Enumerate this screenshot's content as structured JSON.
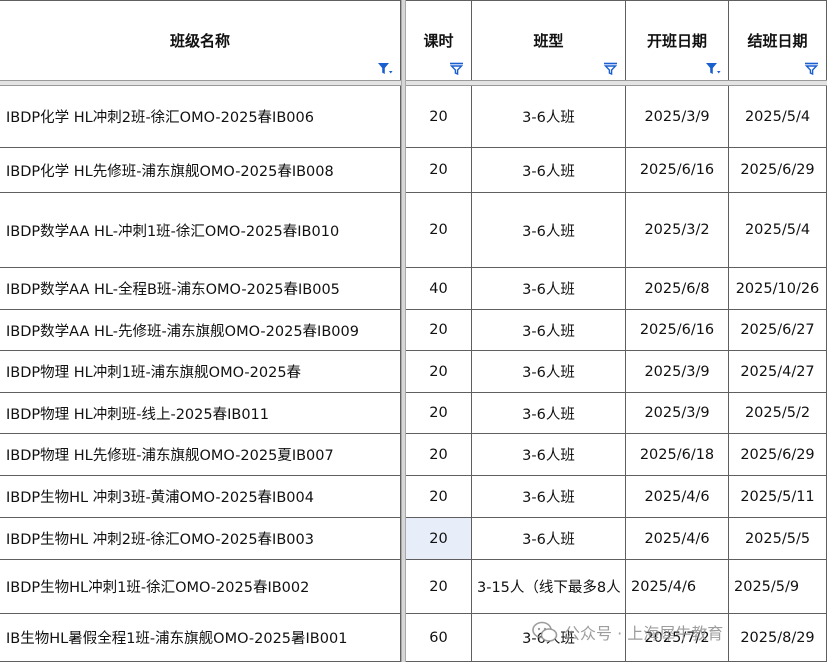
{
  "headers": [
    {
      "label": "班级名称",
      "filter": "active"
    },
    {
      "label": "课时",
      "filter": "funnel"
    },
    {
      "label": "班型",
      "filter": "funnel"
    },
    {
      "label": "开班日期",
      "filter": "active"
    },
    {
      "label": "结班日期",
      "filter": "funnel"
    }
  ],
  "rows": [
    {
      "name": "IBDP化学 HL冲刺2班-徐汇OMO-2025春IB006",
      "hours": "20",
      "type": "3-6人班",
      "start": "2025/3/9",
      "end": "2025/5/4"
    },
    {
      "name": "IBDP化学 HL先修班-浦东旗舰OMO-2025春IB008",
      "hours": "20",
      "type": "3-6人班",
      "start": "2025/6/16",
      "end": "2025/6/29"
    },
    {
      "name": "IBDP数学AA HL-冲刺1班-徐汇OMO-2025春IB010",
      "hours": "20",
      "type": "3-6人班",
      "start": "2025/3/2",
      "end": "2025/5/4"
    },
    {
      "name": "IBDP数学AA HL-全程B班-浦东OMO-2025春IB005",
      "hours": "40",
      "type": "3-6人班",
      "start": "2025/6/8",
      "end": "2025/10/26"
    },
    {
      "name": "IBDP数学AA HL-先修班-浦东旗舰OMO-2025春IB009",
      "hours": "20",
      "type": "3-6人班",
      "start": "2025/6/16",
      "end": "2025/6/27"
    },
    {
      "name": "IBDP物理 HL冲刺1班-浦东旗舰OMO-2025春",
      "hours": "20",
      "type": "3-6人班",
      "start": "2025/3/9",
      "end": "2025/4/27"
    },
    {
      "name": "IBDP物理 HL冲刺班-线上-2025春IB011",
      "hours": "20",
      "type": "3-6人班",
      "start": "2025/3/9",
      "end": "2025/5/2"
    },
    {
      "name": "IBDP物理 HL先修班-浦东旗舰OMO-2025夏IB007",
      "hours": "20",
      "type": "3-6人班",
      "start": "2025/6/18",
      "end": "2025/6/29"
    },
    {
      "name": "IBDP生物HL 冲刺3班-黄浦OMO-2025春IB004",
      "hours": "20",
      "type": "3-6人班",
      "start": "2025/4/6",
      "end": "2025/5/11"
    },
    {
      "name": "IBDP生物HL 冲刺2班-徐汇OMO-2025春IB003",
      "hours": "20",
      "type": "3-6人班",
      "start": "2025/4/6",
      "end": "2025/5/5"
    },
    {
      "name": "IBDP生物HL冲刺1班-徐汇OMO-2025春IB002",
      "hours": "20",
      "type": "3-15人（线下最多8人",
      "start": "2025/4/6",
      "end": "2025/5/9"
    },
    {
      "name": "IB生物HL暑假全程1班-浦东旗舰OMO-2025暑IB001",
      "hours": "60",
      "type": "3-6人班",
      "start": "2025/7/2",
      "end": "2025/8/29"
    }
  ],
  "watermark": {
    "label": "公众号 · 上海犀牛教育"
  },
  "colors": {
    "filter_icon": "#1a5fd0",
    "selected_cell": "#e7eef9",
    "grid": "#5f5f5f"
  }
}
